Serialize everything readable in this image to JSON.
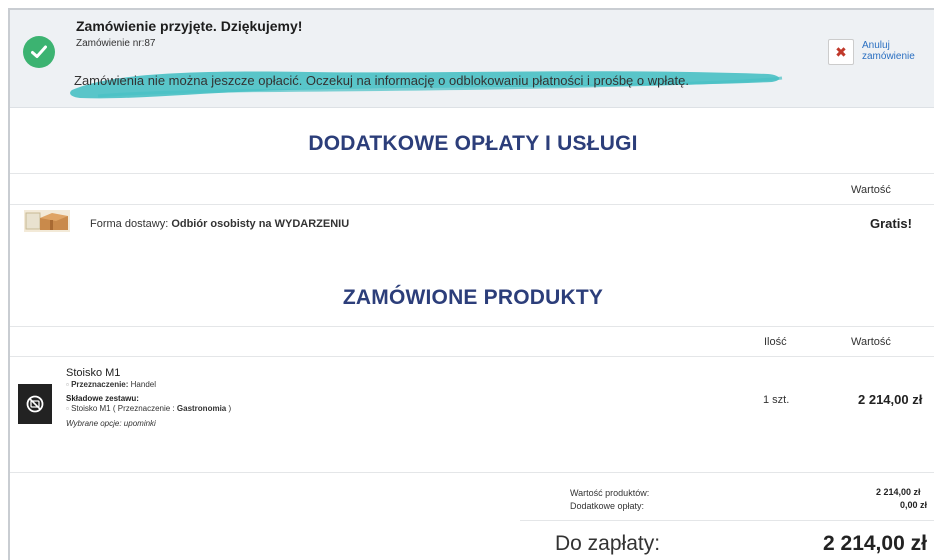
{
  "notice": {
    "title": "Zamówienie przyjęte. Dziękujemy!",
    "order_number": "Zamówienie nr:87",
    "info": "Zamówienia nie można jeszcze opłacić. Oczekuj na informację o odblokowaniu płatności i prośbę o wpłatę.",
    "cancel_label_line1": "Anuluj",
    "cancel_label_line2": "zamówienie",
    "cancel_glyph": "✖"
  },
  "extra": {
    "title": "DODATKOWE OPŁATY I USŁUGI",
    "col_value": "Wartość",
    "delivery_prefix": "Forma dostawy: ",
    "delivery_name": "Odbiór osobisty na WYDARZENIU",
    "delivery_price": "Gratis!"
  },
  "products": {
    "title": "ZAMÓWIONE PRODUKTY",
    "col_qty": "Ilość",
    "col_value": "Wartość",
    "items": [
      {
        "name": "Stoisko M1",
        "attr_label": "Przeznaczenie:",
        "attr_value": " Handel",
        "components_label": "Składowe zestawu:",
        "component_text": "Stoisko M1 ( Przeznaczenie : ",
        "component_value": "Gastronomia",
        "component_close": " )",
        "options": "Wybrane opcje: upominki",
        "qty": "1 szt.",
        "price": "2 214,00 zł"
      }
    ]
  },
  "summary": {
    "products_label": "Wartość produktów:",
    "products_value": "2 214,00 zł",
    "extra_label": "Dodatkowe opłaty:",
    "extra_value": "0,00 zł",
    "total_label": "Do zapłaty:",
    "total_value": "2 214,00 zł"
  },
  "colors": {
    "accent": "#2c3e7a",
    "success": "#3cb371",
    "brush": "#48c0c4",
    "link": "#2a6fc1"
  }
}
